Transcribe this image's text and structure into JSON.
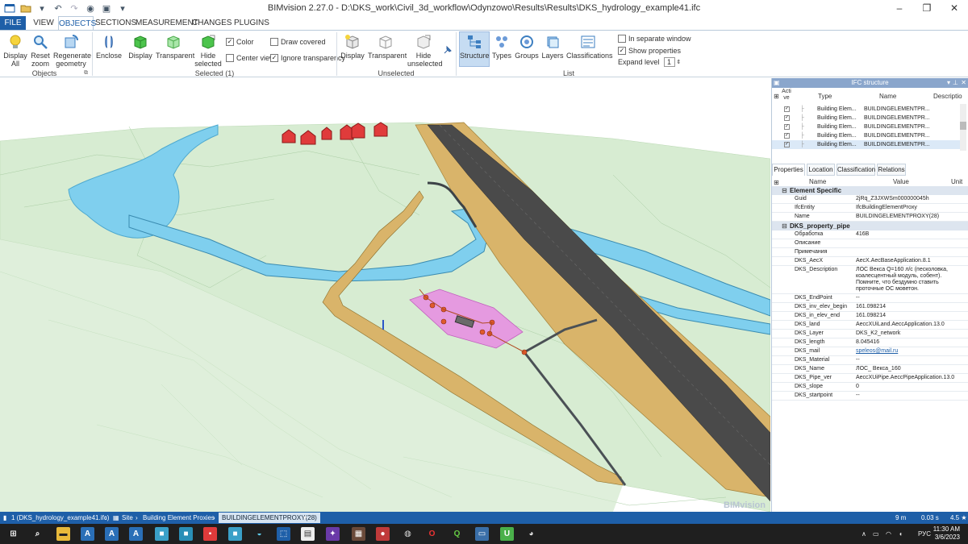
{
  "window": {
    "title": "BIMvision 2.27.0 - D:\\DKS_work\\Civil_3d_workflow\\Odynzowo\\Results\\Results\\DKS_hydrology_example41.ifc"
  },
  "menu": {
    "tabs": [
      "FILE",
      "VIEW",
      "OBJECTS",
      "SECTIONS",
      "MEASUREMENT",
      "CHANGES",
      "PLUGINS"
    ],
    "active": "OBJECTS"
  },
  "ribbon": {
    "objects": {
      "display_all": "Display All",
      "reset_zoom": "Reset zoom",
      "regenerate": "Regenerate geometry",
      "group": "Objects"
    },
    "selected": {
      "enclose": "Enclose",
      "display": "Display",
      "transparent": "Transparent",
      "hide_selected": "Hide selected",
      "color": "Color",
      "center_view": "Center view",
      "draw_covered": "Draw covered",
      "ignore_transparency": "Ignore transparency",
      "group": "Selected (1)"
    },
    "unselected": {
      "display": "Display",
      "transparent": "Transparent",
      "hide_unselected": "Hide unselected",
      "group": "Unselected"
    },
    "list": {
      "structure": "Structure",
      "types": "Types",
      "groups": "Groups",
      "layers": "Layers",
      "classifications": "Classifications",
      "group": "List"
    },
    "options": {
      "separate_window": "In separate window",
      "show_properties": "Show properties",
      "expand_level": "Expand level",
      "expand_value": "1"
    }
  },
  "ifc_panel": {
    "title": "IFC structure",
    "columns": {
      "active": "Acti ve",
      "type": "Type",
      "name": "Name",
      "description": "Descriptio"
    },
    "rows": [
      {
        "type": "Building Elem...",
        "name": "BUILDINGELEMENTPR..."
      },
      {
        "type": "Building Elem...",
        "name": "BUILDINGELEMENTPR..."
      },
      {
        "type": "Building Elem...",
        "name": "BUILDINGELEMENTPR..."
      },
      {
        "type": "Building Elem...",
        "name": "BUILDINGELEMENTPR..."
      },
      {
        "type": "Building Elem...",
        "name": "BUILDINGELEMENTPR..."
      }
    ]
  },
  "props_panel": {
    "tabs": [
      "Properties",
      "Location",
      "Classification",
      "Relations"
    ],
    "columns": {
      "name": "Name",
      "value": "Value",
      "unit": "Unit"
    },
    "element_specific": {
      "header": "Element Specific",
      "rows": [
        {
          "name": "Guid",
          "value": "2jRq_Z3JXWSm000000045h"
        },
        {
          "name": "IfcEntity",
          "value": "IfcBuildingElementProxy"
        },
        {
          "name": "Name",
          "value": "BUILDINGELEMENTPROXY(28)"
        }
      ]
    },
    "dks_property_pipe": {
      "header": "DKS_property_pipe",
      "rows": [
        {
          "name": "Обработка",
          "value": "416В"
        },
        {
          "name": "Описание",
          "value": ""
        },
        {
          "name": "Примечания",
          "value": ""
        },
        {
          "name": "DKS_AecX",
          "value": "AecX.AecBaseApplication.8.1"
        },
        {
          "name": "DKS_Description",
          "value": "ЛОС Векса Q=160 л/с (песколовка, коалесцентный модуль, собент). Помните, что бездумно ставить проточные ОС моветон."
        },
        {
          "name": "DKS_EndPoint",
          "value": "--"
        },
        {
          "name": "DKS_inv_elev_begin",
          "value": "161.098214"
        },
        {
          "name": "DKS_in_elev_end",
          "value": "161.098214"
        },
        {
          "name": "DKS_land",
          "value": "AeccXUiLand.AeccApplication.13.0"
        },
        {
          "name": "DKS_Layer",
          "value": "DKS_K2_network"
        },
        {
          "name": "DKS_length",
          "value": "8.045416"
        },
        {
          "name": "DKS_mail",
          "value": "speleos@mail.ru"
        },
        {
          "name": "DKS_Material",
          "value": "--"
        },
        {
          "name": "DKS_Name",
          "value": "ЛОС_ Векса_160"
        },
        {
          "name": "DKS_Pipe_ver",
          "value": "AeccXUiPipe.AeccPipeApplication.13.0"
        },
        {
          "name": "DKS_slope",
          "value": "0"
        },
        {
          "name": "DKS_startpoint",
          "value": "--"
        }
      ]
    }
  },
  "viewport": {
    "watermark": "BIMvision"
  },
  "status": {
    "file": "1 (DKS_hydrology_example41.ifc)",
    "site": "Site",
    "proxies": "Building Element Proxies",
    "selected": "BUILDINGELEMENTPROXY(28)",
    "distance": "9 m",
    "time": "0.03 s",
    "fps": "4.5 ★"
  },
  "taskbar": {
    "lang": "РУС",
    "time": "11:30 AM",
    "date": "3/6/2023"
  },
  "colors": {
    "accent": "#1e5fa8",
    "terrain": "#d7ecd2",
    "water": "#7fcfee",
    "embankment": "#d9b46a",
    "road": "#4a4a4a",
    "pad": "#e59ae0",
    "house": "#e03b3b"
  }
}
